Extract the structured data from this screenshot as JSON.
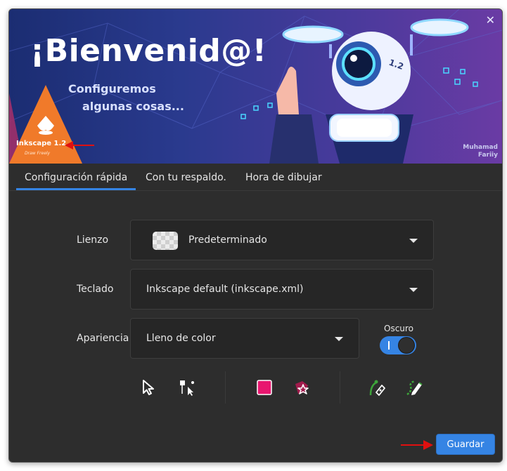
{
  "banner": {
    "welcome": "¡Bienvenid@!",
    "subtitle_line1": "Configuremos",
    "subtitle_line2": "algunas cosas...",
    "version_badge": "1.2",
    "logo_name": "Inkscape 1.2",
    "logo_tagline": "Draw Freely",
    "credit_line1": "Muhamad",
    "credit_line2": "Fariiy",
    "close_icon": "close-icon"
  },
  "tabs": [
    {
      "label": "Configuración rápida",
      "active": true
    },
    {
      "label": "Con tu respaldo.",
      "active": false
    },
    {
      "label": "Hora de dibujar",
      "active": false
    }
  ],
  "form": {
    "canvas_label": "Lienzo",
    "canvas_value": "Predeterminado",
    "keyboard_label": "Teclado",
    "keyboard_value": "Inkscape default (inkscape.xml)",
    "appearance_label": "Apariencia",
    "appearance_value": "Lleno de color",
    "dark_label": "Oscuro",
    "dark_enabled": true
  },
  "tools": [
    "selector-icon",
    "node-icon",
    "rectangle-icon",
    "star-icon",
    "pen-icon",
    "pencil-icon"
  ],
  "colors": {
    "accent": "#3584e4",
    "background": "#2d2d2d",
    "rect_tool": "#e8166f",
    "pen_tool": "#3da43a"
  },
  "footer": {
    "save_label": "Guardar"
  }
}
